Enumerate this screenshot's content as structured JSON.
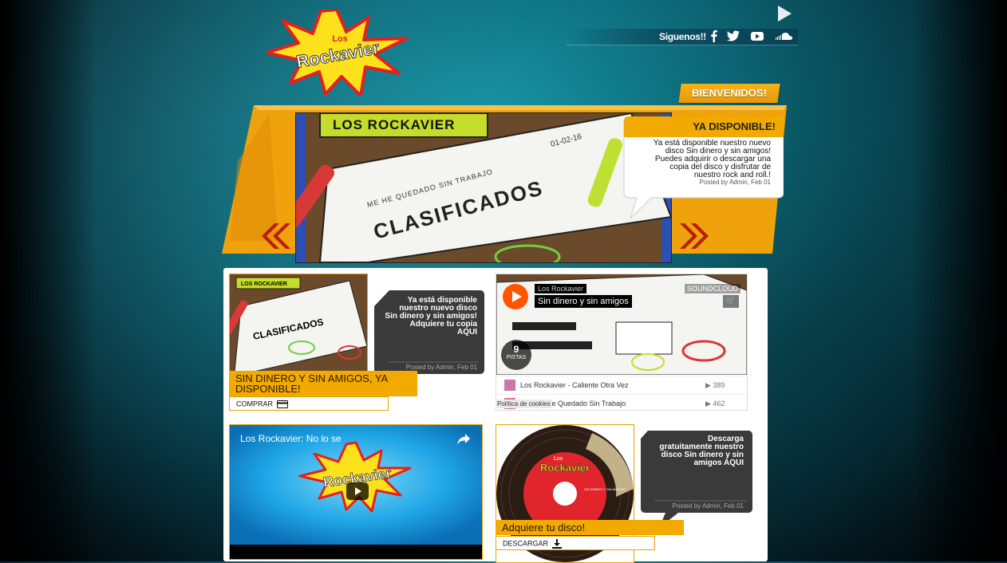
{
  "header": {
    "logo_text_small": "Los",
    "logo_text": "Rockavier",
    "follow_label": "Siguenos!!",
    "social_icons": [
      "facebook-icon",
      "twitter-icon",
      "youtube-icon",
      "soundcloud-icon"
    ],
    "welcome_label": "BIENVENIDOS!"
  },
  "slider": {
    "image_banner": "LOS ROCKAVIER",
    "image_heading": "CLASIFICADOS",
    "image_subheading": "ME HE QUEDADO SIN TRABAJO",
    "image_date": "01-02-16",
    "bubble_title": "YA DISPONIBLE!",
    "bubble_text": [
      "Ya está disponible nuestro nuevo",
      "disco Sin dinero y sin amigos!",
      "Puedes adquirir o descargar una",
      "copia del disco y disfrutar de",
      "nuestro rock and roll.!"
    ],
    "bubble_meta": "Posted by Admin, Feb 01"
  },
  "post1": {
    "bubble_text": [
      "Ya está disponible",
      "nuestro nuevo disco",
      "Sin dinero y sin amigos!",
      "Adquiere tu copia",
      "AQUI"
    ],
    "meta": "Posted by Admin, Feb 01",
    "title": "SIN DINERO Y SIN AMIGOS, YA DISPONIBLE!",
    "button_label": "COMPRAR"
  },
  "soundcloud": {
    "artist": "Los Rockavier",
    "title": "Sin dinero y sin amigos",
    "brand": "SOUNDCLOUD",
    "track_count": "9",
    "track_label": "PISTAS",
    "tracks": [
      {
        "name": "Los Rockavier - Caliente Otra Vez",
        "plays": "389"
      },
      {
        "name": "ier - Me He Quedado Sin Trabajo",
        "plays": "462"
      }
    ],
    "cookies": "Política de cookies"
  },
  "video": {
    "title": "Los Rockavier: No lo se"
  },
  "post2": {
    "bubble_text": [
      "Descarga",
      "gratuitamente nuestro",
      "disco Sin dinero y sin",
      "amigos AQUI"
    ],
    "meta": "Posted by Admin, Feb 01",
    "title": "Adquiere tu disco!",
    "button_label": "DESCARGAR",
    "disc_label": "Rockavier",
    "disc_small": "Los",
    "disc_sub": "SIN DINERO Y SIN AMIGOS"
  },
  "colors": {
    "accent": "#f2a900",
    "bg_teal": "#0d6f7f",
    "soundcloud": "#ff5500"
  }
}
